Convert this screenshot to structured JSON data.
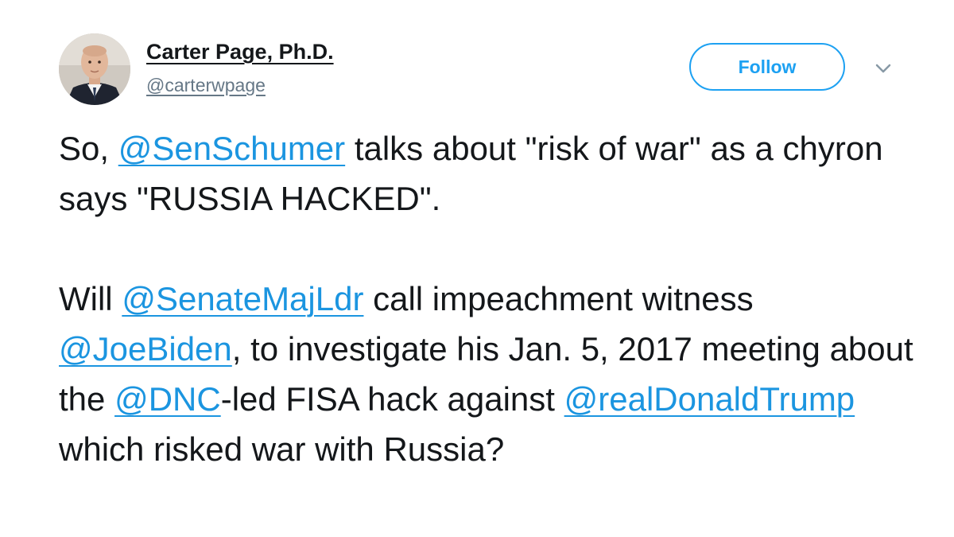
{
  "author": {
    "display_name": "Carter Page, Ph.D.",
    "handle": "@carterwpage",
    "avatar_icon": "profile-photo"
  },
  "actions": {
    "follow_label": "Follow",
    "more_icon": "chevron-down-icon"
  },
  "tweet": {
    "paragraph1": {
      "t1": "So, ",
      "m1": "@SenSchumer",
      "t2": " talks about \"risk of war\" as a chyron says \"RUSSIA HACKED\"."
    },
    "paragraph2": {
      "t1": "Will ",
      "m1": "@SenateMajLdr",
      "t2": " call impeachment witness ",
      "m2": "@JoeBiden",
      "t3": ", to investigate his Jan. 5, 2017 meeting about the ",
      "m3": "@DNC",
      "t4": "-led FISA hack against ",
      "m4": "@realDonaldTrump",
      "t5": " which risked war with Russia?"
    }
  },
  "colors": {
    "accent": "#1da1f2",
    "mention": "#1b95e0",
    "text": "#14171a",
    "secondary": "#657786"
  }
}
